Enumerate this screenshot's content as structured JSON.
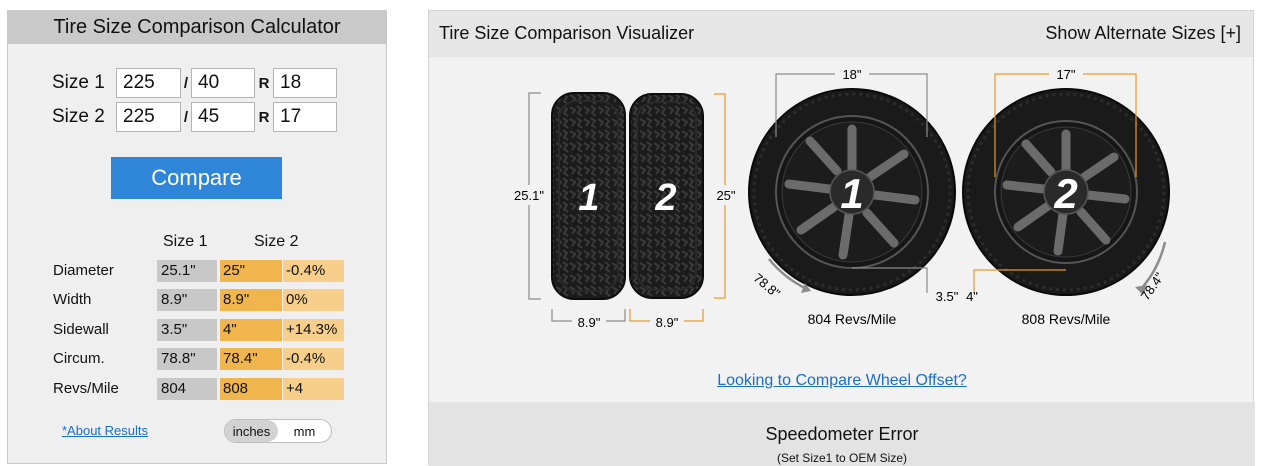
{
  "calculator": {
    "title": "Tire Size Comparison Calculator",
    "size1": {
      "label": "Size 1",
      "width": "225",
      "aspect": "40",
      "rim": "18"
    },
    "size2": {
      "label": "Size 2",
      "width": "225",
      "aspect": "45",
      "rim": "17"
    },
    "slash": "/",
    "r": "R",
    "compare_label": "Compare",
    "col1": "Size 1",
    "col2": "Size 2",
    "rows": [
      {
        "label": "Diameter",
        "v1": "25.1\"",
        "v2": "25\"",
        "diff": "-0.4%"
      },
      {
        "label": "Width",
        "v1": "8.9\"",
        "v2": "8.9\"",
        "diff": "0%"
      },
      {
        "label": "Sidewall",
        "v1": "3.5\"",
        "v2": "4\"",
        "diff": "+14.3%"
      },
      {
        "label": "Circum.",
        "v1": "78.8\"",
        "v2": "78.4\"",
        "diff": "-0.4%"
      },
      {
        "label": "Revs/Mile",
        "v1": "804",
        "v2": "808",
        "diff": "+4"
      }
    ],
    "about_link": "*About Results",
    "units": {
      "inches": "inches",
      "mm": "mm",
      "selected": "inches"
    }
  },
  "visualizer": {
    "title": "Tire Size Comparison Visualizer",
    "alt_sizes": "Show Alternate Sizes [+]",
    "tire1": {
      "num": "1",
      "height": "25.1\"",
      "width": "8.9\"",
      "rim": "18\"",
      "sidewall": "3.5\"",
      "circ": "78.8\"",
      "revs": "804 Revs/Mile"
    },
    "tire2": {
      "num": "2",
      "height": "25\"",
      "width": "8.9\"",
      "rim": "17\"",
      "sidewall": "4\"",
      "circ": "78.4\"",
      "revs": "808 Revs/Mile"
    },
    "offset_link": "Looking to Compare Wheel Offset?",
    "speedo_title": "Speedometer Error",
    "speedo_sub": "(Set Size1 to OEM Size)"
  },
  "colors": {
    "accent": "#2f86d8",
    "size1_cell": "#c8c8c8",
    "size2_cell": "#f0b54c",
    "diff_cell": "#f7cf8a",
    "tire2_line": "#e89a2a",
    "link": "#1a6fc7"
  }
}
